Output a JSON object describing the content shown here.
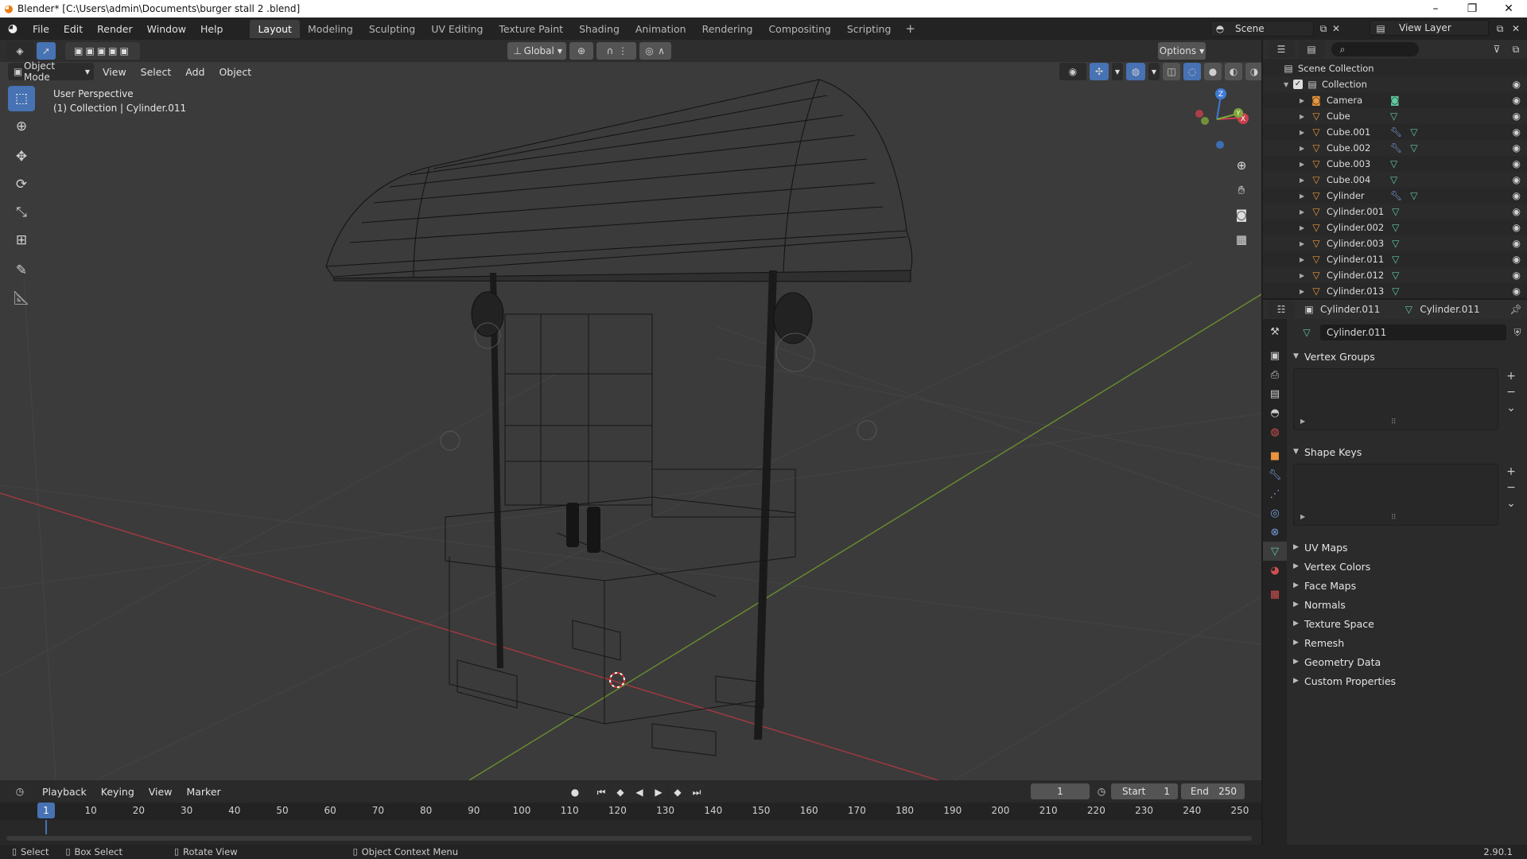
{
  "window": {
    "title": "Blender* [C:\\Users\\admin\\Documents\\burger stall 2 .blend]",
    "controls": [
      "–",
      "❐",
      "✕"
    ]
  },
  "menu": {
    "items": [
      "File",
      "Edit",
      "Render",
      "Window",
      "Help"
    ],
    "workspaces": [
      "Layout",
      "Modeling",
      "Sculpting",
      "UV Editing",
      "Texture Paint",
      "Shading",
      "Animation",
      "Rendering",
      "Compositing",
      "Scripting"
    ],
    "active_workspace": "Layout",
    "add_tab": "+",
    "scene": "Scene",
    "view_layer": "View Layer"
  },
  "viewport": {
    "transform_orientation": "Global",
    "options_label": "Options",
    "mode": "Object Mode",
    "menus": [
      "View",
      "Select",
      "Add",
      "Object"
    ],
    "info_line1": "User Perspective",
    "info_line2": "(1) Collection | Cylinder.011",
    "gizmo_axes": {
      "x": "X",
      "y": "Y",
      "z": "Z"
    }
  },
  "timeline": {
    "menus": [
      "Playback",
      "Keying",
      "View",
      "Marker"
    ],
    "current_frame": "1",
    "start_label": "Start",
    "start": "1",
    "end_label": "End",
    "end": "250",
    "ruler_current": "1",
    "ruler_ticks": [
      "10",
      "20",
      "30",
      "40",
      "50",
      "60",
      "70",
      "80",
      "90",
      "100",
      "110",
      "120",
      "130",
      "140",
      "150",
      "160",
      "170",
      "180",
      "190",
      "200",
      "210",
      "220",
      "230",
      "240",
      "250"
    ]
  },
  "statusbar": {
    "select": "Select",
    "box_select": "Box Select",
    "rotate_view": "Rotate View",
    "context_menu": "Object Context Menu",
    "version": "2.90.1"
  },
  "outliner": {
    "scene_collection": "Scene Collection",
    "collection": "Collection",
    "items": [
      {
        "name": "Camera",
        "icon": "camera-icon",
        "mods": []
      },
      {
        "name": "Cube",
        "icon": "mesh-object-icon",
        "mods": [
          "mesh"
        ]
      },
      {
        "name": "Cube.001",
        "icon": "mesh-object-icon",
        "mods": [
          "modifier",
          "mesh"
        ]
      },
      {
        "name": "Cube.002",
        "icon": "mesh-object-icon",
        "mods": [
          "modifier",
          "mesh"
        ]
      },
      {
        "name": "Cube.003",
        "icon": "mesh-object-icon",
        "mods": [
          "mesh"
        ]
      },
      {
        "name": "Cube.004",
        "icon": "mesh-object-icon",
        "mods": [
          "mesh"
        ]
      },
      {
        "name": "Cylinder",
        "icon": "mesh-object-icon",
        "mods": [
          "modifier",
          "mesh"
        ]
      },
      {
        "name": "Cylinder.001",
        "icon": "mesh-object-icon",
        "mods": [
          "mesh"
        ]
      },
      {
        "name": "Cylinder.002",
        "icon": "mesh-object-icon",
        "mods": [
          "mesh"
        ]
      },
      {
        "name": "Cylinder.003",
        "icon": "mesh-object-icon",
        "mods": [
          "mesh"
        ]
      },
      {
        "name": "Cylinder.011",
        "icon": "mesh-object-icon",
        "mods": [
          "mesh"
        ]
      },
      {
        "name": "Cylinder.012",
        "icon": "mesh-object-icon",
        "mods": [
          "mesh"
        ]
      },
      {
        "name": "Cylinder.013",
        "icon": "mesh-object-icon",
        "mods": [
          "mesh"
        ]
      }
    ]
  },
  "properties": {
    "breadcrumb_object": "Cylinder.011",
    "breadcrumb_mesh": "Cylinder.011",
    "mesh_name": "Cylinder.011",
    "panels": {
      "vertex_groups": "Vertex Groups",
      "shape_keys": "Shape Keys",
      "uv_maps": "UV Maps",
      "vertex_colors": "Vertex Colors",
      "face_maps": "Face Maps",
      "normals": "Normals",
      "texture_space": "Texture Space",
      "remesh": "Remesh",
      "geometry_data": "Geometry Data",
      "custom_properties": "Custom Properties"
    }
  },
  "colors": {
    "accent": "#4772b3",
    "x_axis": "#c8404c",
    "y_axis": "#7ea83b",
    "z_axis": "#3f7ad4",
    "object_orange": "#e8943c",
    "mesh_green": "#5fc9a0"
  }
}
